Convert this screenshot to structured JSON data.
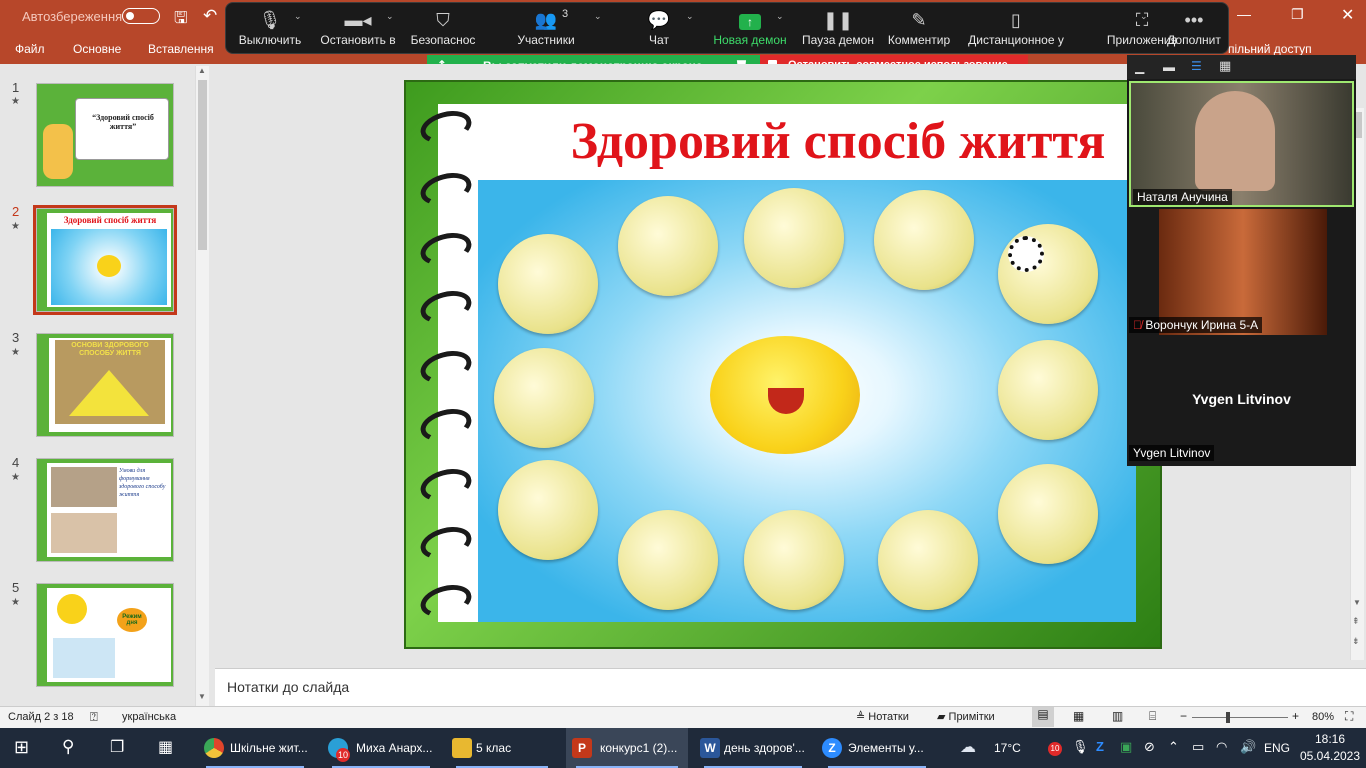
{
  "titlebar": {
    "autosave_label": "Автозбереження"
  },
  "ribbon": {
    "tabs": [
      "Файл",
      "Основне",
      "Вставлення"
    ],
    "share_label": "пільний доступ"
  },
  "zoom_toolbar": {
    "items": [
      {
        "label": "Выключить",
        "icon": "microphone-icon"
      },
      {
        "label": "Остановить в",
        "icon": "video-camera-icon"
      },
      {
        "label": "Безопаснос",
        "icon": "shield-icon"
      },
      {
        "label": "Участники",
        "icon": "participants-icon",
        "badge": "3"
      },
      {
        "label": "Чат",
        "icon": "chat-icon"
      },
      {
        "label": "Новая демон",
        "icon": "share-screen-icon"
      },
      {
        "label": "Пауза демон",
        "icon": "pause-icon"
      },
      {
        "label": "Комментир",
        "icon": "pencil-icon"
      },
      {
        "label": "Дистанционное у",
        "icon": "mouse-icon"
      },
      {
        "label": "Приложения",
        "icon": "apps-icon"
      },
      {
        "label": "Дополнит",
        "icon": "more-icon"
      }
    ],
    "share_notice": "Вы запустили демонстрацию экрана",
    "stop_share": "Остановить совместное использование",
    "accent": "#22b14c",
    "stop_color": "#e02a2a"
  },
  "slides": [
    {
      "num": "1",
      "title": "“Здоровий спосіб життя”"
    },
    {
      "num": "2",
      "title": "Здоровий спосіб життя"
    },
    {
      "num": "3",
      "title": "ОСНОВИ ЗДОРОВОГО СПОСОБУ ЖИТТЯ"
    },
    {
      "num": "4",
      "title": "Умови для формування здорового способу життя"
    },
    {
      "num": "5",
      "title": "Режим дня"
    }
  ],
  "slide": {
    "title": "Здоровий спосіб життя"
  },
  "notes_placeholder": "Нотатки до слайда",
  "gallery": {
    "participants": [
      {
        "name": "Наталя Анучина",
        "muted": false
      },
      {
        "name": "Ворончук Ирина 5-А",
        "muted": true
      },
      {
        "name": "Yvgen Litvinov",
        "muted": false
      }
    ]
  },
  "statusbar": {
    "slide_info": "Слайд 2 з 18",
    "language": "українська",
    "notes_btn": "Нотатки",
    "comments_btn": "Примітки",
    "zoom": "80%"
  },
  "taskbar": {
    "apps": [
      {
        "label": "Шкільне жит...",
        "color": "#e0452b"
      },
      {
        "label": "Миха Анарх...",
        "color": "#2a9fd6",
        "badge": "10"
      },
      {
        "label": "5 клас",
        "color": "#e8b830"
      },
      {
        "label": "конкурс1 (2)...",
        "color": "#c4381a"
      },
      {
        "label": "день здоров'...",
        "color": "#2b579a"
      },
      {
        "label": "Элементы у...",
        "color": "#2d8cff"
      }
    ],
    "weather": "17°C",
    "lang": "ENG",
    "time": "18:16",
    "date": "05.04.2023",
    "tray_badge": "10"
  }
}
